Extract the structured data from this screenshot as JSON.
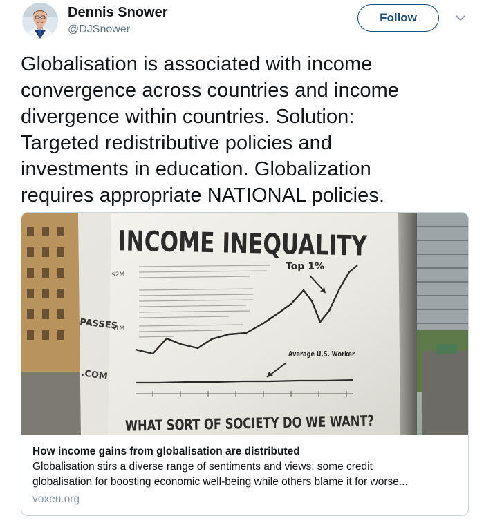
{
  "author": {
    "name": "Dennis Snower",
    "handle": "@DJSnower",
    "avatar_icon": "profile-photo"
  },
  "follow_button": {
    "label": "Follow"
  },
  "menu": {
    "icon": "chevron-down-icon"
  },
  "tweet": {
    "lines": [
      "Globalisation is associated with income",
      "convergence across countries and income",
      "divergence within countries. Solution:",
      "Targeted redistributive policies and",
      "investments in education. Globalization",
      "requires appropriate NATIONAL policies."
    ]
  },
  "card": {
    "image": {
      "headline": "INCOME INEQUALITY",
      "top_label": "Top 1%",
      "avg_label": "Average U.S. Worker",
      "footer": "WHAT SORT OF SOCIETY DO WE WANT?",
      "side_text_1": "PASSES",
      "side_text_2": ".COM"
    },
    "title": "How income gains from globalisation are distributed",
    "description_lines": [
      "Globalisation stirs a diverse range of sentiments and views: some credit",
      "globalisation for boosting economic well-being while others blame it for worse..."
    ],
    "domain": "voxeu.org"
  },
  "colors": {
    "follow_accent": "#1d4e7d",
    "secondary_text": "#657786",
    "card_border": "#ccd6dd"
  }
}
